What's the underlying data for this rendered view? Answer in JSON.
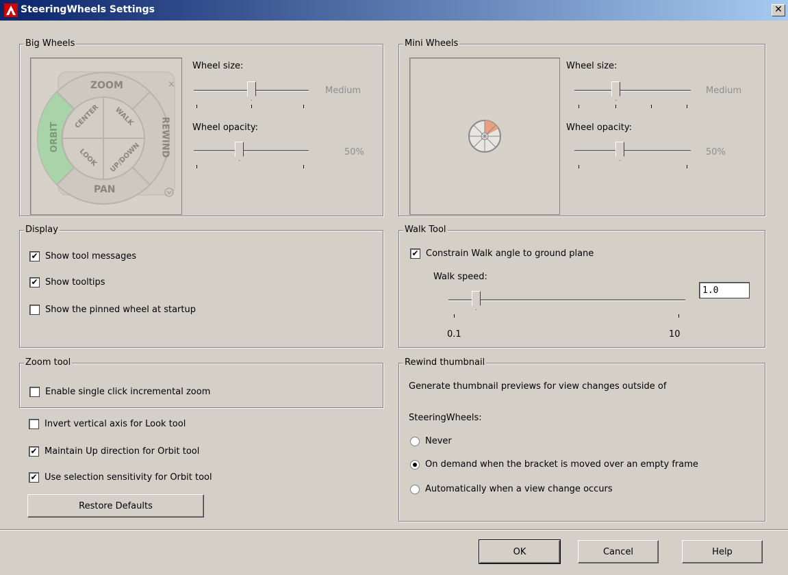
{
  "title": "SteeringWheels Settings",
  "close_label": "✕",
  "big_wheels": {
    "title": "Big Wheels",
    "wheel_labels": {
      "zoom": "ZOOM",
      "orbit": "ORBIT",
      "rewind": "REWIND",
      "pan": "PAN",
      "center": "CENTER",
      "walk": "WALK",
      "look": "LOOK",
      "updown": "UP/DOWN"
    },
    "wheel_size_label": "Wheel size:",
    "wheel_size_value": "Medium",
    "wheel_opacity_label": "Wheel opacity:",
    "wheel_opacity_value": "50%"
  },
  "mini_wheels": {
    "title": "Mini Wheels",
    "wheel_size_label": "Wheel size:",
    "wheel_size_value": "Medium",
    "wheel_opacity_label": "Wheel opacity:",
    "wheel_opacity_value": "50%"
  },
  "display": {
    "title": "Display",
    "show_tool_messages": "Show tool messages",
    "show_tooltips": "Show tooltips",
    "show_pinned_wheel": "Show the pinned wheel at startup"
  },
  "walk_tool": {
    "title": "Walk Tool",
    "constrain": "Constrain Walk angle to ground plane",
    "speed_label": "Walk speed:",
    "speed_value": "1.0",
    "min": "0.1",
    "max": "10"
  },
  "zoom_tool": {
    "title": "Zoom tool",
    "single_click": "Enable single click incremental zoom"
  },
  "options": {
    "invert_vertical": "Invert vertical axis for Look tool",
    "maintain_up": "Maintain Up direction for Orbit tool",
    "selection_sensitivity": "Use selection sensitivity for Orbit tool",
    "restore_defaults": "Restore Defaults"
  },
  "rewind": {
    "title": "Rewind thumbnail",
    "desc_line1": "Generate thumbnail previews for view changes outside of",
    "desc_line2": "SteeringWheels:",
    "never": "Never",
    "on_demand": "On demand when the bracket is moved over an empty frame",
    "automatically": "Automatically when a view change occurs"
  },
  "footer": {
    "ok": "OK",
    "cancel": "Cancel",
    "help": "Help"
  },
  "state": {
    "show_tool_messages": true,
    "show_tooltips": true,
    "show_pinned_wheel": false,
    "constrain_walk": true,
    "single_click_zoom": false,
    "invert_vertical": false,
    "maintain_up": true,
    "selection_sensitivity": true,
    "rewind_selected": "on_demand"
  },
  "colors": {
    "title_bar_start": "#0a246a",
    "title_bar_end": "#a6caf0",
    "orbit_highlight": "#a9d3a9",
    "dialog_bg": "#d4d0c8"
  },
  "icons": {
    "app": "autocad-icon",
    "close": "close-icon",
    "check": "checkmark-icon"
  }
}
